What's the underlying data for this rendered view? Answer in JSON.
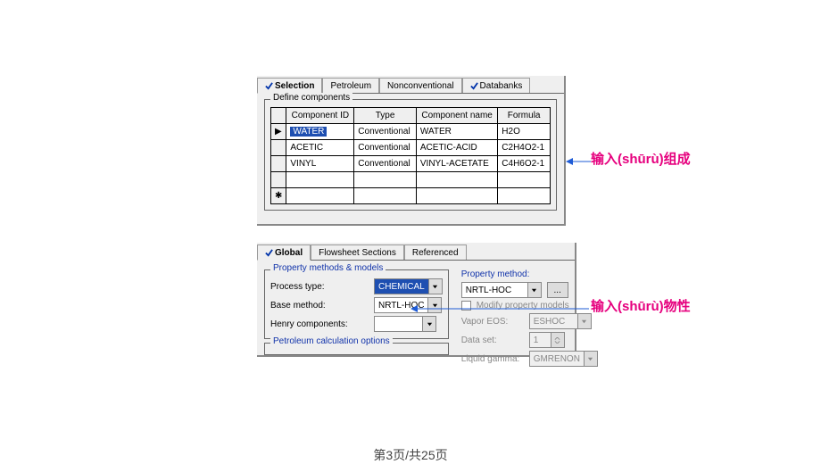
{
  "panel_top": {
    "tabs": [
      "Selection",
      "Petroleum",
      "Nonconventional",
      "Databanks"
    ],
    "group_label": "Define components",
    "headers": [
      "Component ID",
      "Type",
      "Component name",
      "Formula"
    ],
    "rows": [
      {
        "marker": "▶",
        "id": "WATER",
        "selected": true,
        "type": "Conventional",
        "name": "WATER",
        "formula": "H2O"
      },
      {
        "marker": "",
        "id": "ACETIC",
        "selected": false,
        "type": "Conventional",
        "name": "ACETIC-ACID",
        "formula": "C2H4O2-1"
      },
      {
        "marker": "",
        "id": "VINYL",
        "selected": false,
        "type": "Conventional",
        "name": "VINYL-ACETATE",
        "formula": "C4H6O2-1"
      },
      {
        "marker": "",
        "id": "",
        "selected": false,
        "type": "",
        "name": "",
        "formula": ""
      },
      {
        "marker": "✱",
        "id": "",
        "selected": false,
        "type": "",
        "name": "",
        "formula": ""
      }
    ]
  },
  "panel_bot": {
    "tabs": [
      "Global",
      "Flowsheet Sections",
      "Referenced"
    ],
    "group1_label": "Property methods & models",
    "process_type_label": "Process type:",
    "process_type_value": "CHEMICAL",
    "base_method_label": "Base method:",
    "base_method_value": "NRTL-HOC",
    "henry_label": "Henry components:",
    "henry_value": "",
    "group2_label": "Petroleum calculation options",
    "prop_method_label": "Property method:",
    "prop_method_value": "NRTL-HOC",
    "modify_label": "Modify property models",
    "vapor_eos_label": "Vapor EOS:",
    "vapor_eos_value": "ESHOC",
    "dataset_label": "Data set:",
    "dataset_value": "1",
    "liquid_label": "Liquid gamma:",
    "liquid_value": "GMRENON"
  },
  "annot1": "输入(shūrù)组成",
  "annot2": "输入(shūrù)物性",
  "footer": "第3页/共25页"
}
